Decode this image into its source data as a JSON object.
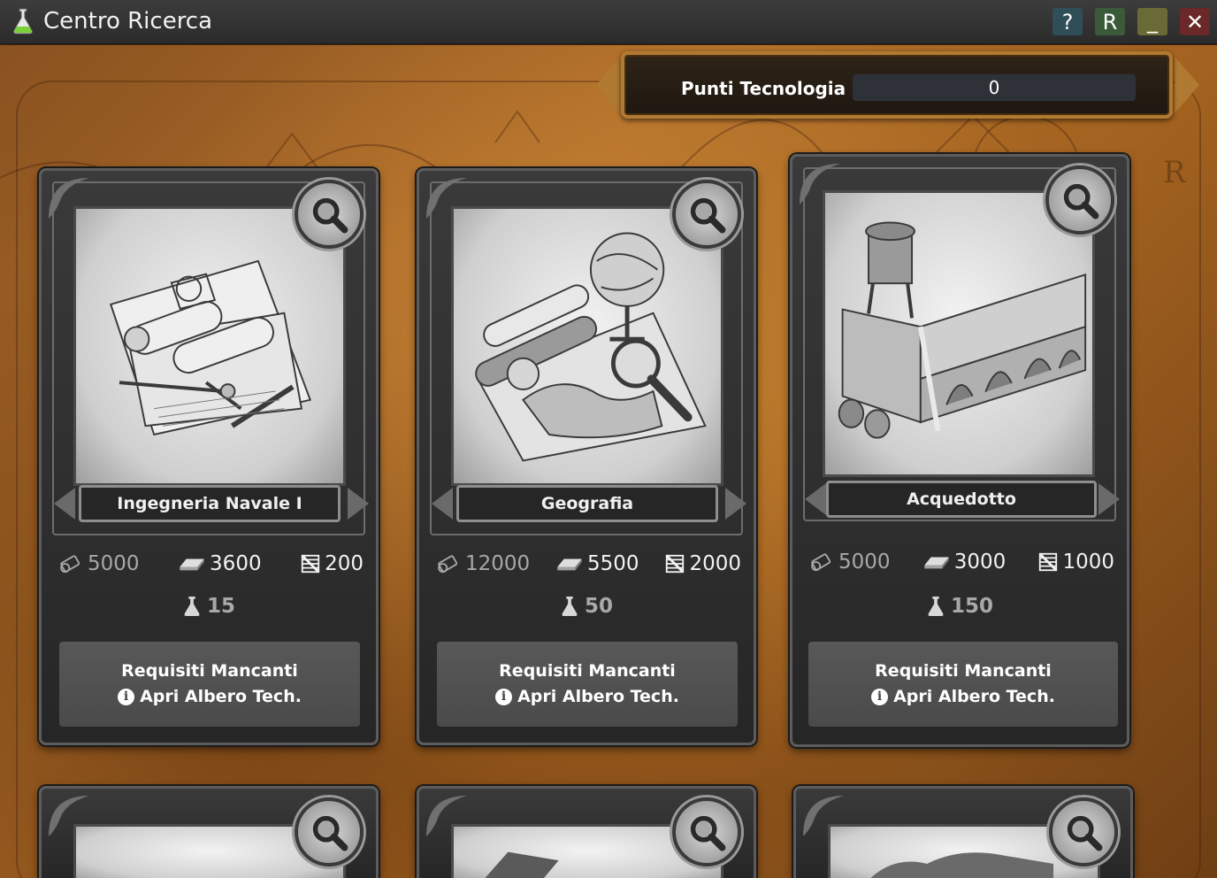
{
  "window": {
    "title": "Centro Ricerca",
    "buttons": {
      "help": "?",
      "r": "R",
      "minimize": "_",
      "close": "✕"
    }
  },
  "tech_points": {
    "label": "Punti Tecnologia",
    "value": "0"
  },
  "cards": [
    {
      "name": "Ingegneria Navale I",
      "costs": {
        "wood": "5000",
        "iron": "3600",
        "cloth": "200"
      },
      "research": "15",
      "button_line1": "Requisiti Mancanti",
      "button_line2": "Apri Albero Tech.",
      "art": "naval-blueprints"
    },
    {
      "name": "Geografia",
      "costs": {
        "wood": "12000",
        "iron": "5500",
        "cloth": "2000"
      },
      "research": "50",
      "button_line1": "Requisiti Mancanti",
      "button_line2": "Apri Albero Tech.",
      "art": "globe-map"
    },
    {
      "name": "Acquedotto",
      "costs": {
        "wood": "5000",
        "iron": "3000",
        "cloth": "1000"
      },
      "research": "150",
      "button_line1": "Requisiti Mancanti",
      "button_line2": "Apri Albero Tech.",
      "art": "aqueduct"
    }
  ],
  "icons": {
    "app": "flask-icon",
    "wood": "wood-log-icon",
    "iron": "iron-ingot-icon",
    "cloth": "cloth-bolt-icon",
    "research": "flask-icon",
    "inspect": "magnifier-icon",
    "info": "info-icon"
  },
  "colors": {
    "frame_gold": "#b07a32",
    "card_bg": "#2e2e2e",
    "button_bg": "#525252",
    "parchment": "#a3621f"
  }
}
